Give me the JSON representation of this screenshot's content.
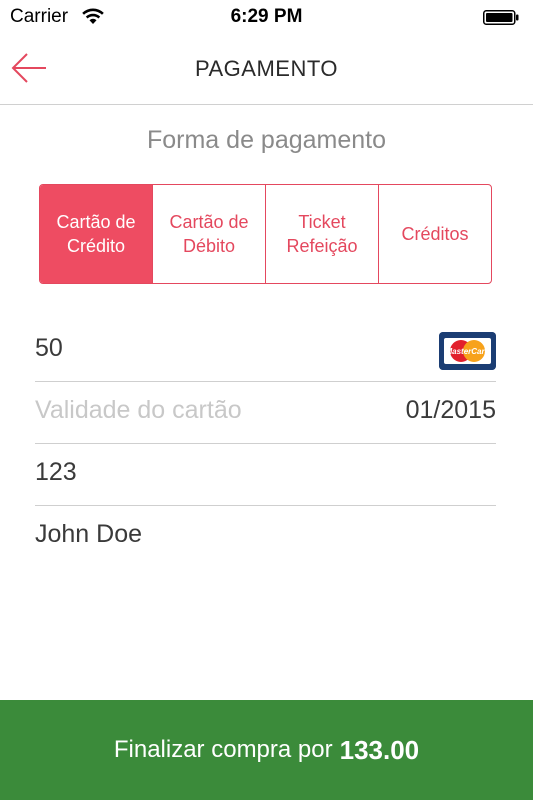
{
  "status_bar": {
    "carrier": "Carrier",
    "time": "6:29 PM",
    "wifi_icon": "wifi-icon",
    "battery_icon": "battery-icon"
  },
  "nav": {
    "title": "PAGAMENTO",
    "back_icon": "arrow-left-icon",
    "accent_color": "#e4485e"
  },
  "payment": {
    "section_title": "Forma de pagamento",
    "methods": [
      {
        "label": "Cartão de\nCrédito",
        "selected": true
      },
      {
        "label": "Cartão de\nDébito",
        "selected": false
      },
      {
        "label": "Ticket\nRefeição",
        "selected": false
      },
      {
        "label": "Créditos",
        "selected": false
      }
    ]
  },
  "form": {
    "card_number": "50",
    "card_brand_icon": "mastercard-icon",
    "card_brand_text": "MasterCard",
    "expiry_placeholder": "Validade do cartão",
    "expiry_value": "01/2015",
    "cvv": "123",
    "holder_name": "John Doe"
  },
  "checkout": {
    "label": "Finalizar compra por",
    "amount": "133.00",
    "color": "#3b8b3a"
  }
}
